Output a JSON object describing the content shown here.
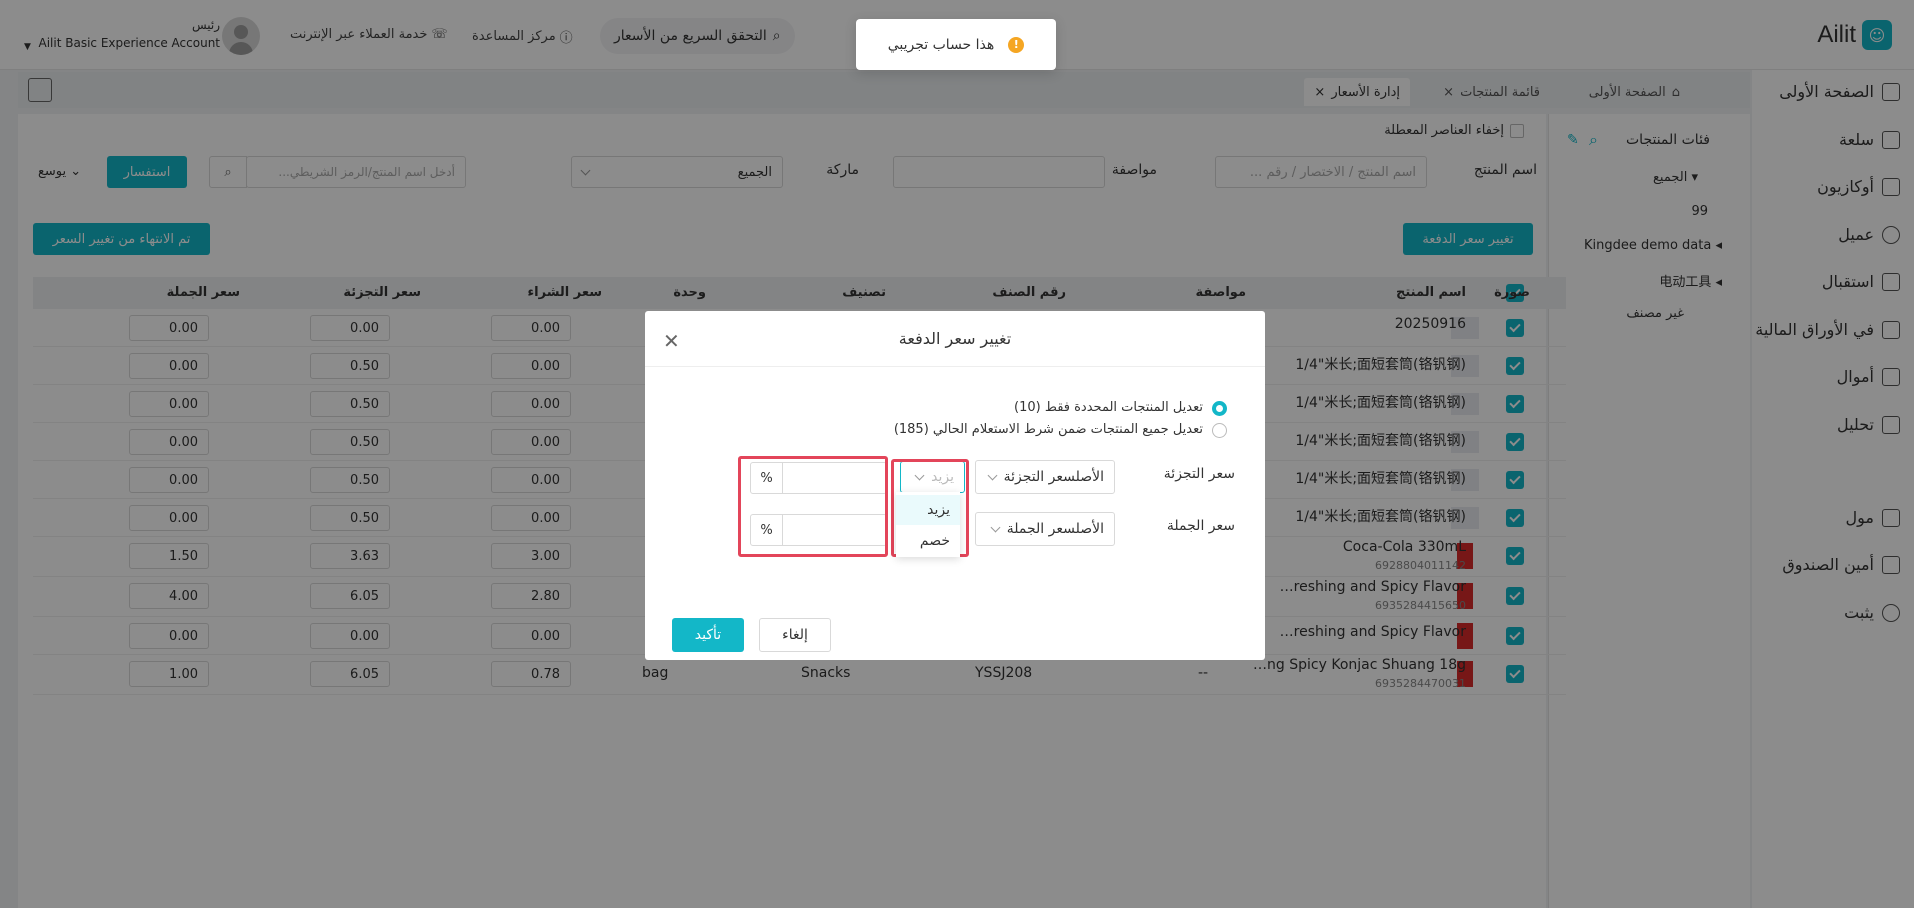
{
  "app": {
    "logo_text": "Ailit",
    "account_role": "رئيس",
    "account_name": "Ailit Basic Experience Account"
  },
  "header": {
    "quick_check": "التحقق السريع من الأسعار",
    "help_center": "مركز المساعدة",
    "online_support": "خدمة العملاء عبر الإنترنت"
  },
  "toast": {
    "text": "هذا حساب تجريبي"
  },
  "sidenav": [
    {
      "label": "الصفحة الأولى",
      "icon": "home-icon"
    },
    {
      "label": "سلعة",
      "icon": "bag-icon"
    },
    {
      "label": "أوكازيون",
      "icon": "clipboard-icon"
    },
    {
      "label": "عميل",
      "icon": "user-icon"
    },
    {
      "label": "استقبال",
      "icon": "inbox-icon"
    },
    {
      "label": "في الأوراق المالية",
      "icon": "house-icon"
    },
    {
      "label": "أموال",
      "icon": "wallet-icon"
    },
    {
      "label": "تحليل",
      "icon": "chart-icon"
    },
    {
      "label": "مول",
      "icon": "store-icon"
    },
    {
      "label": "أمين الصندوق",
      "icon": "cashier-icon"
    },
    {
      "label": "يثبت",
      "icon": "gear-icon"
    }
  ],
  "tabs": [
    {
      "label": "الصفحة الأولى"
    },
    {
      "label": "قائمة المنتجات"
    },
    {
      "label": "إدارة الأسعار"
    }
  ],
  "categories": {
    "title": "فئات المنتجات",
    "all": "الجميع",
    "count": "99",
    "items": [
      "Kingdee demo data",
      "电动工具",
      "غير مصنف"
    ]
  },
  "filters": {
    "hide_disabled": "إخفاء العناصر المعطلة",
    "product_name_label": "اسم المنتج",
    "product_name_placeholder": "اسم المنتج / الاختصار / رقم ...",
    "spec_label": "مواصفة",
    "brand_label": "ماركة",
    "brand_value": "الجميع",
    "search_placeholder": "أدخل اسم المنتج/الرمز الشريطي...",
    "query_button": "استفسار",
    "expand_label": "يوسع",
    "batch_change_button": "تغيير سعر الدفعة",
    "done_button": "تم الانتهاء من تغيير السعر"
  },
  "table": {
    "headers": [
      "صورة",
      "اسم المنتج",
      "مواصفة",
      "رقم الصنف",
      "تصنيف",
      "وحدة",
      "سعر الشراء",
      "سعر التجزئة",
      "سعر الجملة"
    ],
    "rows": [
      {
        "name": "20250916",
        "barcode": "",
        "img": "blank",
        "purchase": "0.00",
        "retail": "0.00",
        "wholesale": "0.00"
      },
      {
        "name": "1/4\"米长;面短套筒(铬钒钢)",
        "barcode": "",
        "img": "blank",
        "purchase": "0.00",
        "retail": "0.50",
        "wholesale": "0.00"
      },
      {
        "name": "1/4\"米长;面短套筒(铬钒钢)",
        "barcode": "",
        "img": "blank",
        "purchase": "0.00",
        "retail": "0.50",
        "wholesale": "0.00"
      },
      {
        "name": "1/4\"米长;面短套筒(铬钒钢)",
        "barcode": "",
        "img": "blank",
        "purchase": "0.00",
        "retail": "0.50",
        "wholesale": "0.00"
      },
      {
        "name": "1/4\"米长;面短套筒(铬钒钢)",
        "barcode": "",
        "img": "blank",
        "purchase": "0.00",
        "retail": "0.50",
        "wholesale": "0.00"
      },
      {
        "name": "1/4\"米长;面短套筒(铬钒钢)",
        "barcode": "",
        "img": "blank",
        "purchase": "0.00",
        "retail": "0.50",
        "wholesale": "0.00"
      },
      {
        "name": "Coca-Cola 330mL",
        "barcode": "6928804011142",
        "img": "red",
        "purchase": "3.00",
        "retail": "3.63",
        "wholesale": "1.50"
      },
      {
        "name": "…reshing and Spicy Flavor",
        "barcode": "6935284415650",
        "img": "red",
        "purchase": "2.80",
        "retail": "6.05",
        "wholesale": "4.00"
      },
      {
        "name": "…reshing and Spicy Flavor",
        "barcode": "",
        "img": "red",
        "purchase": "0.00",
        "retail": "0.00",
        "wholesale": "0.00"
      },
      {
        "name": "…ng Spicy Konjac Shuang 18g",
        "barcode": "6935284470031",
        "img": "red",
        "purchase": "0.78",
        "retail": "6.05",
        "wholesale": "1.00",
        "spec": "--",
        "item_no": "YSSJ208",
        "category": "Snacks",
        "unit": "bag"
      }
    ]
  },
  "modal": {
    "title": "تغيير سعر الدفعة",
    "option_selected": "تعديل المنتجات المحددة فقط (10)",
    "option_all": "تعديل جميع المنتجات ضمن شرط الاستعلام الحالي (185)",
    "retail_label": "سعر التجزئة",
    "wholesale_label": "سعر الجملة",
    "retail_base": "الأصلسعر التجزئة",
    "wholesale_base": "الأصلسعر الجملة",
    "op_placeholder": "يزيد",
    "percent": "%",
    "dropdown": [
      "يزيد",
      "خصم"
    ],
    "cancel": "إلغاء",
    "confirm": "تأكيد"
  }
}
